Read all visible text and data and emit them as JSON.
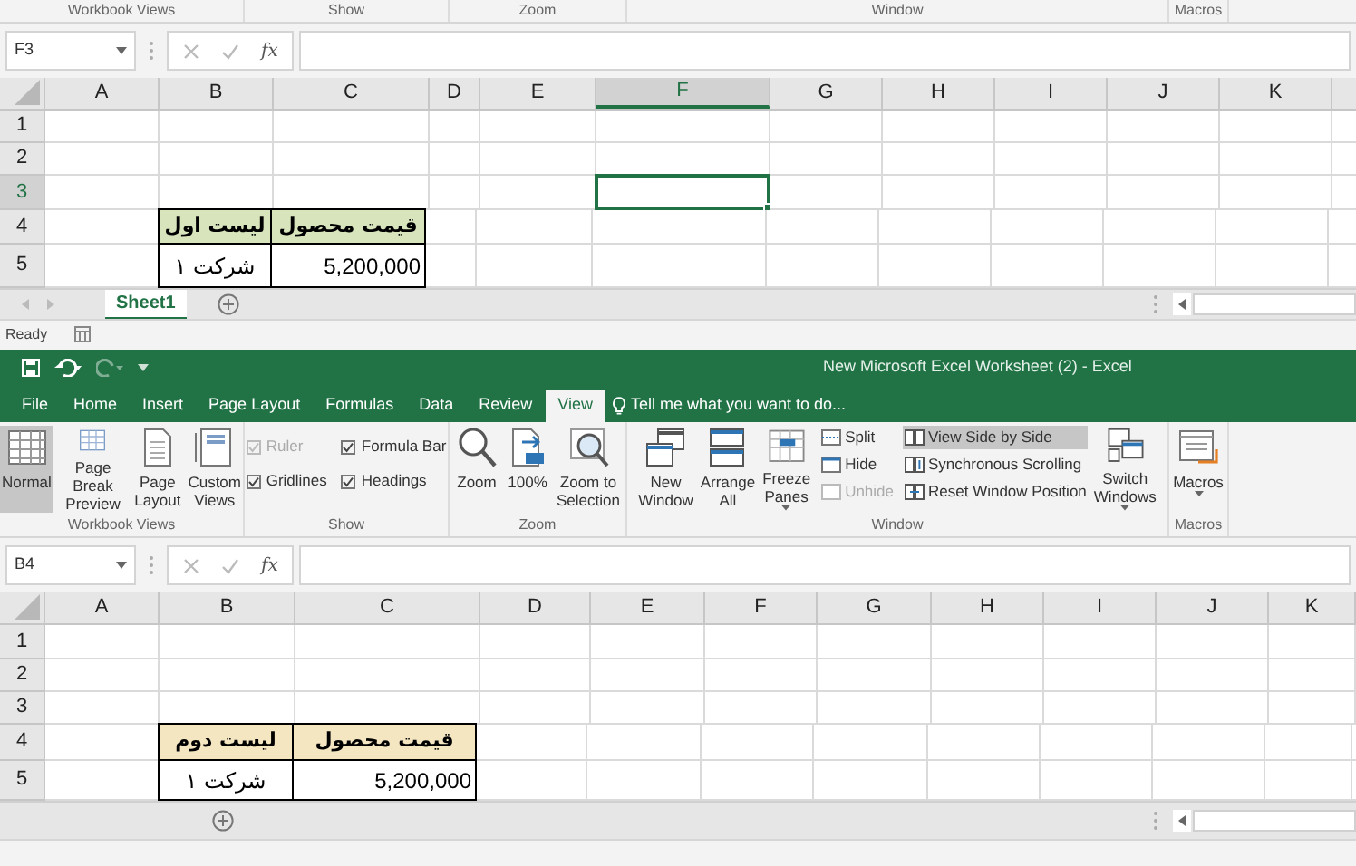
{
  "top_window": {
    "ribbon_group_labels": [
      "Workbook Views",
      "Show",
      "Zoom",
      "Window",
      "Macros"
    ],
    "name_box": "F3",
    "function_label": "fx",
    "columns": [
      {
        "label": "A",
        "selected": false
      },
      {
        "label": "B",
        "selected": false
      },
      {
        "label": "C",
        "selected": false
      },
      {
        "label": "D",
        "selected": false
      },
      {
        "label": "E",
        "selected": false
      },
      {
        "label": "F",
        "selected": true
      },
      {
        "label": "G",
        "selected": false
      },
      {
        "label": "H",
        "selected": false
      },
      {
        "label": "I",
        "selected": false
      },
      {
        "label": "J",
        "selected": false
      },
      {
        "label": "K",
        "selected": false
      }
    ],
    "rows": [
      {
        "label": "1",
        "selected": false
      },
      {
        "label": "2",
        "selected": false
      },
      {
        "label": "3",
        "selected": true
      },
      {
        "label": "4",
        "selected": false
      },
      {
        "label": "5",
        "selected": false
      }
    ],
    "table": {
      "columns": [
        {
          "header": "قیمت محصول",
          "values": [
            "5,200,000"
          ]
        },
        {
          "header": "لیست اول",
          "values": [
            "شرکت ۱"
          ]
        }
      ]
    },
    "sheet_tabs": [
      {
        "label": "Sheet1",
        "selected": true
      }
    ],
    "status": "Ready"
  },
  "bottom_window": {
    "title": "New Microsoft Excel Worksheet (2) - Excel",
    "tabs": [
      {
        "label": "File",
        "selected": false
      },
      {
        "label": "Home",
        "selected": false
      },
      {
        "label": "Insert",
        "selected": false
      },
      {
        "label": "Page Layout",
        "selected": false
      },
      {
        "label": "Formulas",
        "selected": false
      },
      {
        "label": "Data",
        "selected": false
      },
      {
        "label": "Review",
        "selected": false
      },
      {
        "label": "View",
        "selected": true
      }
    ],
    "tell_me": {
      "placeholder": "Tell me what you want to do..."
    },
    "ribbon_groups": [
      {
        "label": "Workbook Views",
        "items": [
          {
            "kind": "large",
            "label": "Normal",
            "selected": true,
            "dropdown": false
          },
          {
            "kind": "large",
            "label": "Page Break\nPreview",
            "selected": false,
            "dropdown": false
          },
          {
            "kind": "large",
            "label": "Page\nLayout",
            "selected": false,
            "dropdown": false
          },
          {
            "kind": "large",
            "label": "Custom\nViews",
            "selected": false,
            "dropdown": false
          }
        ]
      },
      {
        "label": "Show",
        "items": [
          {
            "kind": "checkbox",
            "label": "Ruler",
            "checked": true,
            "disabled": true
          },
          {
            "kind": "checkbox",
            "label": "Formula Bar",
            "checked": true,
            "disabled": false
          },
          {
            "kind": "checkbox",
            "label": "Gridlines",
            "checked": true,
            "disabled": false
          },
          {
            "kind": "checkbox",
            "label": "Headings",
            "checked": true,
            "disabled": false
          }
        ]
      },
      {
        "label": "Zoom",
        "items": [
          {
            "kind": "large",
            "label": "Zoom",
            "selected": false,
            "dropdown": false
          },
          {
            "kind": "large",
            "label": "100%",
            "selected": false,
            "dropdown": false
          },
          {
            "kind": "large",
            "label": "Zoom to\nSelection",
            "selected": false,
            "dropdown": false
          }
        ]
      },
      {
        "label": "Window",
        "items": [
          {
            "kind": "large",
            "label": "New\nWindow",
            "selected": false,
            "dropdown": false
          },
          {
            "kind": "large",
            "label": "Arrange\nAll",
            "selected": false,
            "dropdown": false
          },
          {
            "kind": "large",
            "label": "Freeze\nPanes",
            "selected": false,
            "dropdown": true
          },
          {
            "kind": "small",
            "label": "Split",
            "selected": false,
            "disabled": false
          },
          {
            "kind": "small",
            "label": "Hide",
            "selected": false,
            "disabled": false
          },
          {
            "kind": "small",
            "label": "Unhide",
            "selected": false,
            "disabled": true
          },
          {
            "kind": "small",
            "label": "View Side by Side",
            "selected": true,
            "disabled": false
          },
          {
            "kind": "small",
            "label": "Synchronous Scrolling",
            "selected": false,
            "disabled": false
          },
          {
            "kind": "small",
            "label": "Reset Window Position",
            "selected": false,
            "disabled": false
          },
          {
            "kind": "large",
            "label": "Switch\nWindows",
            "selected": false,
            "dropdown": true
          }
        ]
      },
      {
        "label": "Macros",
        "items": [
          {
            "kind": "large",
            "label": "Macros",
            "selected": false,
            "dropdown": true
          }
        ]
      }
    ],
    "name_box": "B4",
    "function_label": "fx",
    "columns": [
      {
        "label": "A",
        "selected": false
      },
      {
        "label": "B",
        "selected": false
      },
      {
        "label": "C",
        "selected": false
      },
      {
        "label": "D",
        "selected": false
      },
      {
        "label": "E",
        "selected": false
      },
      {
        "label": "F",
        "selected": false
      },
      {
        "label": "G",
        "selected": false
      },
      {
        "label": "H",
        "selected": false
      },
      {
        "label": "I",
        "selected": false
      },
      {
        "label": "J",
        "selected": false
      },
      {
        "label": "K",
        "selected": false
      }
    ],
    "rows": [
      {
        "label": "1",
        "selected": false
      },
      {
        "label": "2",
        "selected": false
      },
      {
        "label": "3",
        "selected": false
      },
      {
        "label": "4",
        "selected": false
      },
      {
        "label": "5",
        "selected": false
      }
    ],
    "table": {
      "columns": [
        {
          "header": "قیمت محصول",
          "values": [
            "5,200,000"
          ]
        },
        {
          "header": "لیست دوم",
          "values": [
            "شرکت ۱"
          ]
        }
      ]
    }
  }
}
